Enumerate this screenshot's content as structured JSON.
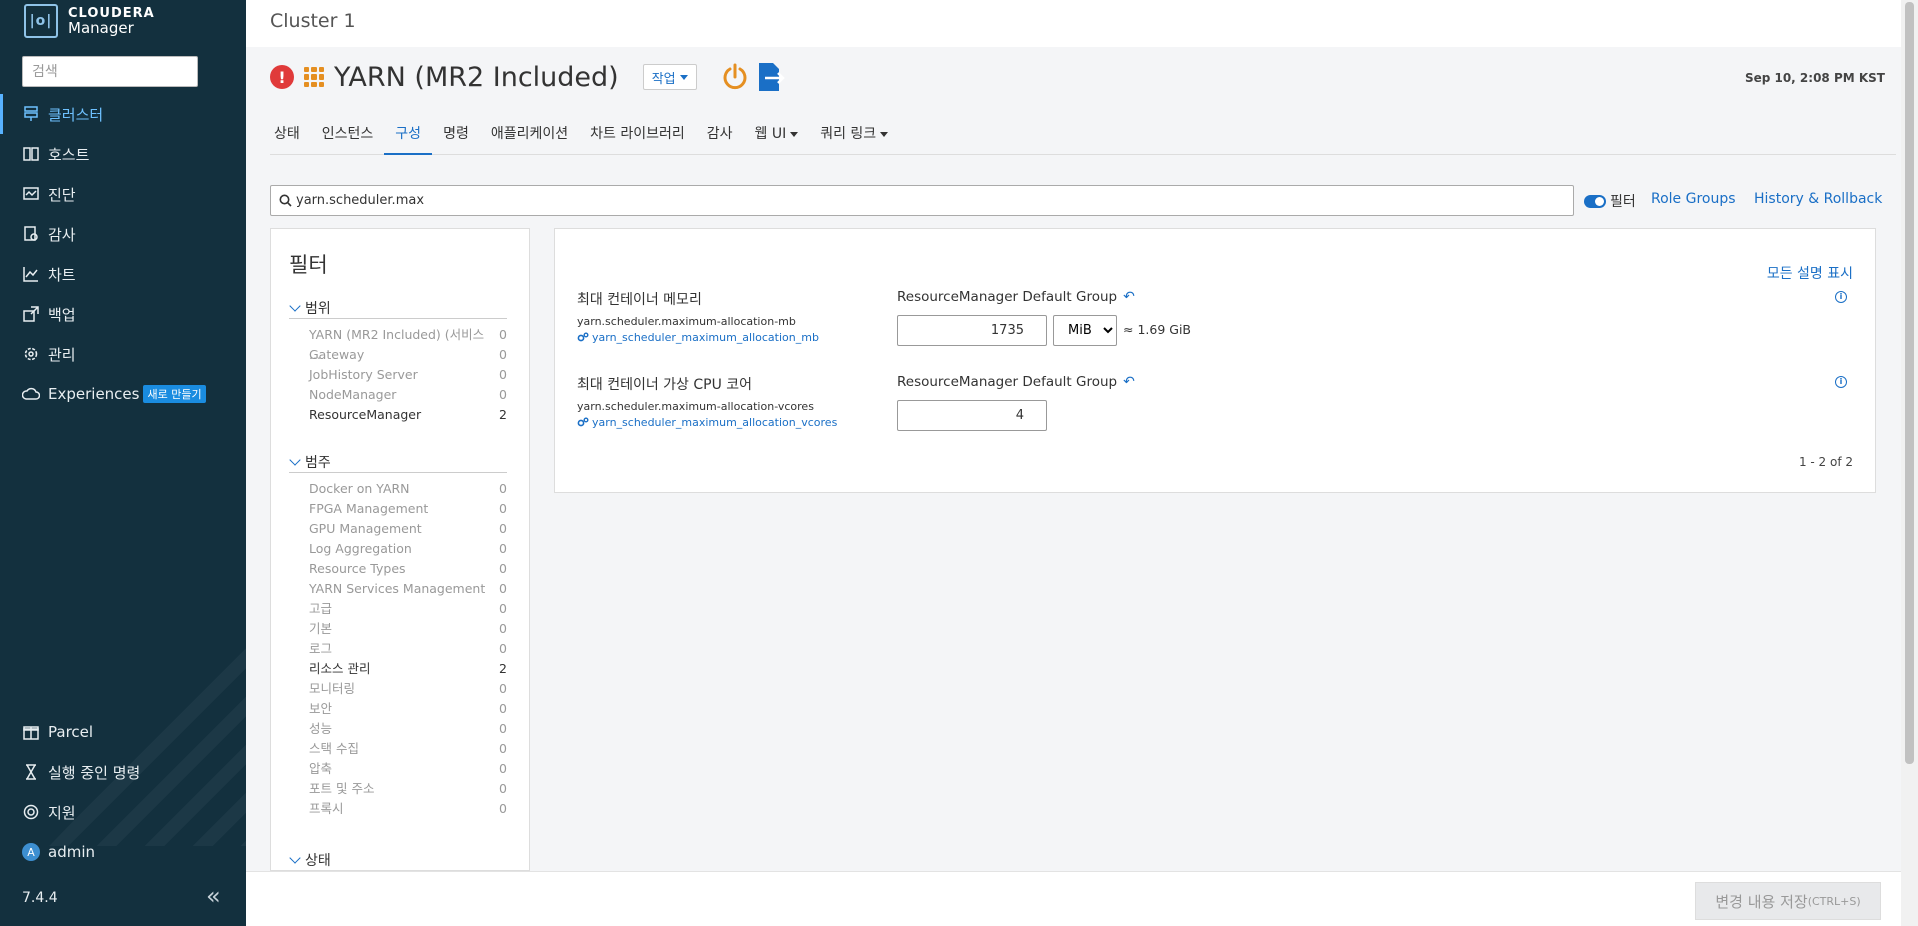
{
  "brand": {
    "line1": "CLOUDERA",
    "line2": "Manager",
    "mark": "|o|"
  },
  "sidebar": {
    "search_placeholder": "검색",
    "items": [
      {
        "label": "클러스터",
        "icon": "cluster-icon",
        "active": true
      },
      {
        "label": "호스트",
        "icon": "hosts-icon"
      },
      {
        "label": "진단",
        "icon": "diagnostics-icon"
      },
      {
        "label": "감사",
        "icon": "audit-icon"
      },
      {
        "label": "차트",
        "icon": "chart-icon"
      },
      {
        "label": "백업",
        "icon": "backup-icon"
      },
      {
        "label": "관리",
        "icon": "gear-icon"
      },
      {
        "label": "Experiences",
        "icon": "cloud-icon",
        "badge": "새로 만들기"
      }
    ],
    "bottom_items": [
      {
        "label": "Parcel",
        "icon": "parcel-icon"
      },
      {
        "label": "실행 중인 명령",
        "icon": "hourglass-icon"
      },
      {
        "label": "지원",
        "icon": "support-icon"
      },
      {
        "label": "admin",
        "icon": "avatar",
        "avatar_letter": "A"
      }
    ],
    "version": "7.4.4",
    "collapse_glyph": "«"
  },
  "header": {
    "cluster": "Cluster 1"
  },
  "service": {
    "alert_glyph": "!",
    "title": "YARN (MR2 Included)",
    "action_label": "작업",
    "timestamp": "Sep 10, 2:08 PM KST"
  },
  "tabs": [
    {
      "label": "상태"
    },
    {
      "label": "인스턴스"
    },
    {
      "label": "구성",
      "active": true
    },
    {
      "label": "명령"
    },
    {
      "label": "애플리케이션"
    },
    {
      "label": "차트 라이브러리"
    },
    {
      "label": "감사"
    },
    {
      "label": "웹 UI",
      "dropdown": true
    },
    {
      "label": "쿼리 링크",
      "dropdown": true
    }
  ],
  "search": {
    "value": "yarn.scheduler.max"
  },
  "toolbar": {
    "filter_label": "필터",
    "role_groups": "Role Groups",
    "history": "History & Rollback"
  },
  "filters": {
    "title": "필터",
    "sections": [
      {
        "title": "범위",
        "items": [
          {
            "label": "YARN (MR2 Included) (서비스 ...",
            "count": "0"
          },
          {
            "label": "Gateway",
            "count": "0"
          },
          {
            "label": "JobHistory Server",
            "count": "0"
          },
          {
            "label": "NodeManager",
            "count": "0"
          },
          {
            "label": "ResourceManager",
            "count": "2",
            "on": true
          }
        ]
      },
      {
        "title": "범주",
        "items": [
          {
            "label": "Docker on YARN",
            "count": "0"
          },
          {
            "label": "FPGA Management",
            "count": "0"
          },
          {
            "label": "GPU Management",
            "count": "0"
          },
          {
            "label": "Log Aggregation",
            "count": "0"
          },
          {
            "label": "Resource Types",
            "count": "0"
          },
          {
            "label": "YARN Services Management",
            "count": "0"
          },
          {
            "label": "고급",
            "count": "0"
          },
          {
            "label": "기본",
            "count": "0"
          },
          {
            "label": "로그",
            "count": "0"
          },
          {
            "label": "리소스 관리",
            "count": "2",
            "on": true
          },
          {
            "label": "모니터링",
            "count": "0"
          },
          {
            "label": "보안",
            "count": "0"
          },
          {
            "label": "성능",
            "count": "0"
          },
          {
            "label": "스택 수집",
            "count": "0"
          },
          {
            "label": "압축",
            "count": "0"
          },
          {
            "label": "포트 및 주소",
            "count": "0"
          },
          {
            "label": "프록시",
            "count": "0"
          }
        ]
      },
      {
        "title": "상태",
        "items": []
      }
    ]
  },
  "config": {
    "show_descriptions": "모든 설명 표시",
    "rows": [
      {
        "label": "최대 컨테이너 메모리",
        "key": "yarn.scheduler.maximum-allocation-mb",
        "var": "yarn_scheduler_maximum_allocation_mb",
        "group": "ResourceManager Default Group",
        "value": "1735",
        "unit": "MiB",
        "approx": "≈ 1.69 GiB"
      },
      {
        "label": "최대 컨테이너 가상 CPU 코어",
        "key": "yarn.scheduler.maximum-allocation-vcores",
        "var": "yarn_scheduler_maximum_allocation_vcores",
        "group": "ResourceManager Default Group",
        "value": "4"
      }
    ],
    "pager": "1 - 2 of 2"
  },
  "footer": {
    "save_label": "변경 내용 저장",
    "shortcut": "(CTRL+S)"
  },
  "colors": {
    "sidebar_bg": "#13303e",
    "accent": "#1a6fc6",
    "alert": "#e03a3a",
    "service_orange": "#e58f21"
  }
}
